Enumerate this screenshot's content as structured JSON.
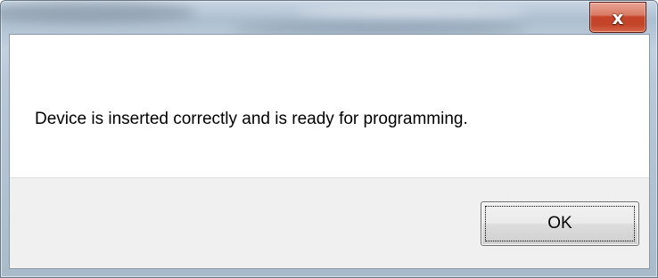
{
  "window": {
    "title": ""
  },
  "title_bar": {
    "close_icon": "close-x-icon",
    "close_glyph": "x"
  },
  "dialog": {
    "message": "Device is inserted correctly and is ready for programming.",
    "ok_label": "OK"
  },
  "colors": {
    "close_button": "#c5442a",
    "button_area": "#f0f0f0",
    "client_background": "#ffffff"
  }
}
